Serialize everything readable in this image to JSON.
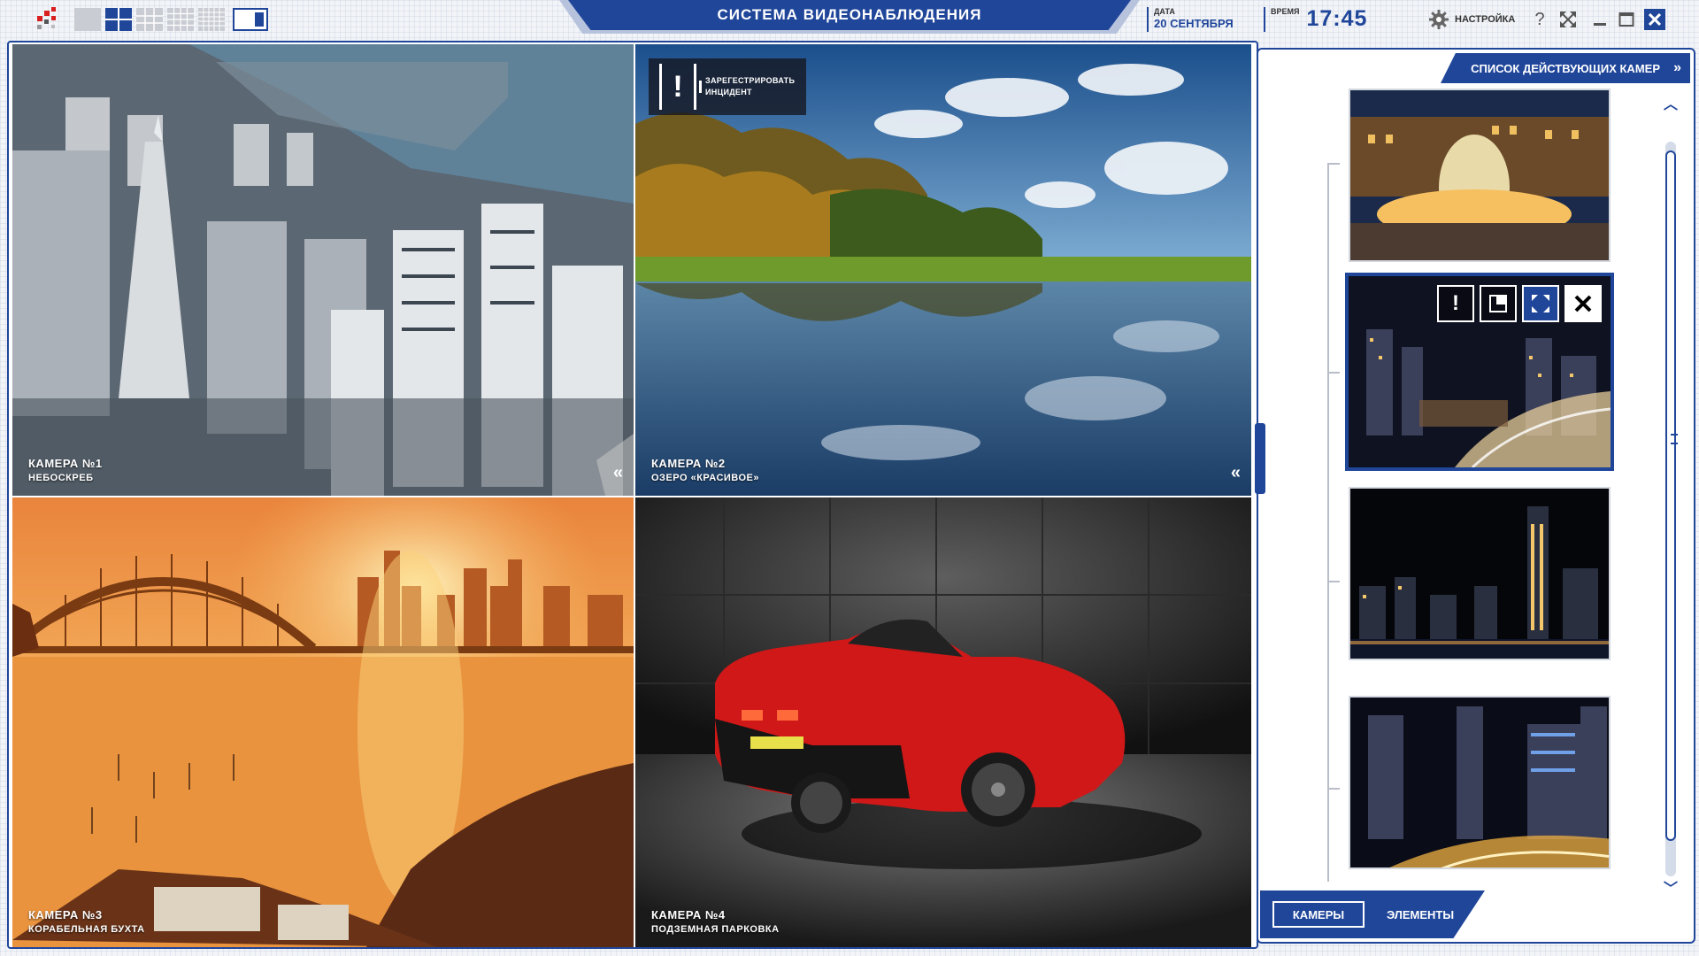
{
  "header": {
    "title": "СИСТЕМА ВИДЕОНАБЛЮДЕНИЯ",
    "date_label": "ДАТА",
    "date_value": "20 СЕНТЯБРЯ",
    "time_label": "ВРЕМЯ",
    "time_value": "17:45",
    "settings_label": "НАСТРОЙКА",
    "help_label": "?"
  },
  "feeds": [
    {
      "camera": "КАМЕРА №1",
      "name": "НЕБОСКРЕБ"
    },
    {
      "camera": "КАМЕРА №2",
      "name": "ОЗЕРО «КРАСИВОЕ»"
    },
    {
      "camera": "КАМЕРА №3",
      "name": "КОРАБЕЛЬНАЯ БУХТА"
    },
    {
      "camera": "КАМЕРА №4",
      "name": "ПОДЗЕМНАЯ ПАРКОВКА"
    }
  ],
  "incident": {
    "label_line1": "ЗАРЕГЕСТРИРОВАТЬ",
    "label_line2": "ИНЦИДЕНТ"
  },
  "panel": {
    "title": "СПИСОК ДЕЙСТВУЮЩИХ КАМЕР",
    "tabs": [
      "КАМЕРЫ",
      "ЭЛЕМЕНТЫ"
    ],
    "selected_tab": "КАМЕРЫ"
  },
  "colors": {
    "accent": "#20469a",
    "logo_red": "#d81e1e"
  }
}
